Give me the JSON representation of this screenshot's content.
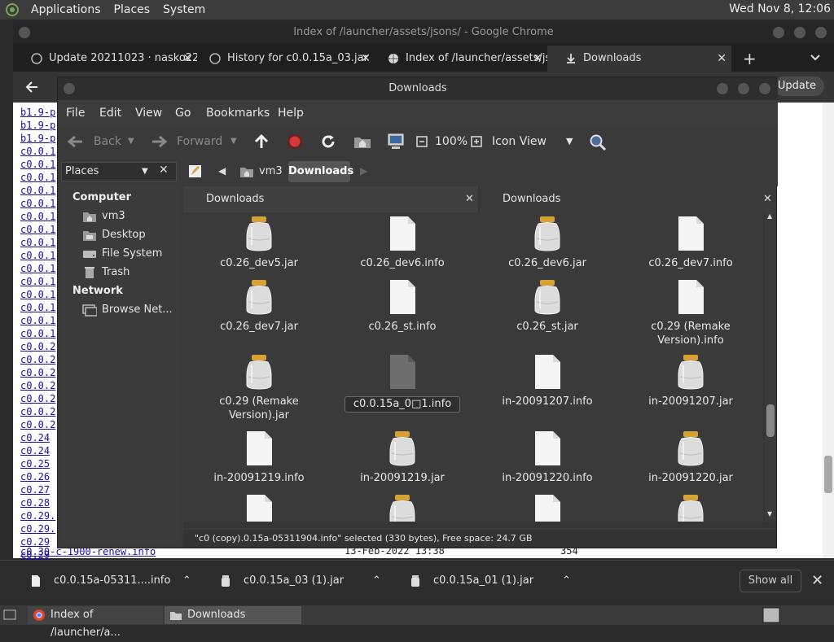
{
  "top_panel": {
    "menus": [
      "Applications",
      "Places",
      "System"
    ],
    "clock": "Wed Nov 8, 12:06"
  },
  "chrome": {
    "window_title": "Index of /launcher/assets/jsons/ - Google Chrome",
    "tabs": [
      {
        "label": "Update 20211023 · nasko22"
      },
      {
        "label": "History for c0.0.15a_03.jar"
      },
      {
        "label": "Index of /launcher/assets/jsons/"
      },
      {
        "label": "Downloads"
      }
    ],
    "update_button": "Update",
    "page_rows": [
      "b1.9-p",
      "b1.9-p",
      "b1.9-p",
      "c0.0.1",
      "c0.0.1",
      "c0.0.1",
      "c0.0.1",
      "c0.0.1",
      "c0.0.1",
      "c0.0.1",
      "c0.0.1",
      "c0.0.1",
      "c0.0.1",
      "c0.0.1",
      "c0.0.1",
      "c0.0.1",
      "c0.0.1",
      "c0.0.1",
      "c0.0.2",
      "c0.0.2",
      "c0.0.2",
      "c0.0.2",
      "c0.0.2",
      "c0.0.2",
      "c0.0.2",
      "c0.24",
      "c0.24",
      "c0.25",
      "c0.26",
      "c0.27",
      "c0.28",
      "c0.29.",
      "c0.29.",
      "c0.29",
      "c0.29"
    ],
    "last_row": {
      "name": "c0.30-c-1900-renew.info",
      "date": "13-Feb-2022 13:38",
      "size": "354"
    }
  },
  "downloads_shelf": {
    "items": [
      {
        "label": "c0.0.15a-05311....info"
      },
      {
        "label": "c0.0.15a_03 (1).jar"
      },
      {
        "label": "c0.0.15a_01 (1).jar"
      }
    ],
    "show_all": "Show all",
    "close": "✕"
  },
  "taskbar": {
    "tasks": [
      {
        "label": "Index of /launcher/a..."
      },
      {
        "label": "Downloads"
      }
    ]
  },
  "file_manager": {
    "title": "Downloads",
    "menus": [
      "File",
      "Edit",
      "View",
      "Go",
      "Bookmarks",
      "Help"
    ],
    "toolbar": {
      "back": "Back",
      "forward": "Forward",
      "zoom": "100%",
      "view_mode": "Icon View"
    },
    "location": [
      "vm3",
      "Downloads"
    ],
    "sidebar": {
      "selector": "Places",
      "computer_heading": "Computer",
      "computer_items": [
        "vm3",
        "Desktop",
        "File System",
        "Trash"
      ],
      "network_heading": "Network",
      "network_items": [
        "Browse Net..."
      ]
    },
    "pane_tabs": [
      "Downloads",
      "Downloads"
    ],
    "files": [
      {
        "name": "c0.26_dev5.jar",
        "kind": "jar"
      },
      {
        "name": "c0.26_dev6.info",
        "kind": "info"
      },
      {
        "name": "c0.26_dev6.jar",
        "kind": "jar"
      },
      {
        "name": "c0.26_dev7.info",
        "kind": "info"
      },
      {
        "name": "c0.26_dev7.jar",
        "kind": "jar"
      },
      {
        "name": "c0.26_st.info",
        "kind": "info"
      },
      {
        "name": "c0.26_st.jar",
        "kind": "jar"
      },
      {
        "name": "c0.29 (Remake Version).info",
        "kind": "info"
      },
      {
        "name": "c0.29 (Remake Version).jar",
        "kind": "jar"
      },
      {
        "name": "c0.0.15a_0□1.info",
        "kind": "info-selected"
      },
      {
        "name": "in-20091207.info",
        "kind": "info"
      },
      {
        "name": "in-20091207.jar",
        "kind": "jar"
      },
      {
        "name": "in-20091219.info",
        "kind": "info"
      },
      {
        "name": "in-20091219.jar",
        "kind": "jar"
      },
      {
        "name": "in-20091220.info",
        "kind": "info"
      },
      {
        "name": "in-20091220.jar",
        "kind": "jar"
      },
      {
        "name": "",
        "kind": "info"
      },
      {
        "name": "",
        "kind": "jar"
      },
      {
        "name": "",
        "kind": "info"
      },
      {
        "name": "",
        "kind": "jar"
      }
    ],
    "status": "\"c0 (copy).0.15a-05311904.info\" selected (330 bytes), Free space: 24.7 GB"
  }
}
